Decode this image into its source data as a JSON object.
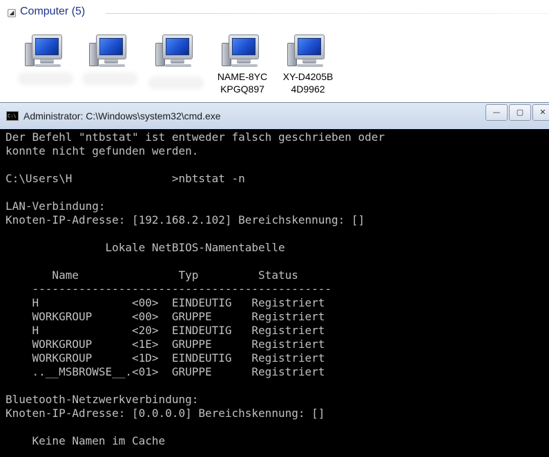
{
  "explorer": {
    "group_title": "Computer (5)",
    "collapse_glyph": "◢",
    "computers": [
      {
        "icon": "computer-icon",
        "label_line1": "",
        "label_line2": "",
        "redacted": true
      },
      {
        "icon": "computer-icon",
        "label_line1": "",
        "label_line2": "",
        "redacted": true
      },
      {
        "icon": "computer-icon",
        "label_line1": "",
        "label_line2": "",
        "redacted": true
      },
      {
        "icon": "computer-icon",
        "label_line1": "NAME-8YC",
        "label_line2": "KPGQ897",
        "redacted": false
      },
      {
        "icon": "computer-icon",
        "label_line1": "XY-D4205B",
        "label_line2": "4D9962",
        "redacted": false
      }
    ]
  },
  "cmd": {
    "icon_text": "C:\\",
    "title": "Administrator: C:\\Windows\\system32\\cmd.exe",
    "minimize_glyph": "—",
    "maximize_glyph": "▢",
    "close_glyph": "✕",
    "lines": [
      "Der Befehl \"ntbstat\" ist entweder falsch geschrieben oder",
      "konnte nicht gefunden werden.",
      "",
      "C:\\Users\\H               >nbtstat -n",
      "",
      "LAN-Verbindung:",
      "Knoten-IP-Adresse: [192.168.2.102] Bereichskennung: []",
      "",
      "               Lokale NetBIOS-Namentabelle",
      "",
      "       Name               Typ         Status",
      "    ---------------------------------------------",
      "    H              <00>  EINDEUTIG   Registriert",
      "    WORKGROUP      <00>  GRUPPE      Registriert",
      "    H              <20>  EINDEUTIG   Registriert",
      "    WORKGROUP      <1E>  GRUPPE      Registriert",
      "    WORKGROUP      <1D>  EINDEUTIG   Registriert",
      "    ..__MSBROWSE__.<01>  GRUPPE      Registriert",
      "",
      "Bluetooth-Netzwerkverbindung:",
      "Knoten-IP-Adresse: [0.0.0.0] Bereichskennung: []",
      "",
      "    Keine Namen im Cache"
    ]
  },
  "colors": {
    "group_title": "#1e3287",
    "console_bg": "#000000",
    "console_fg": "#c0c0c0",
    "titlebar": "#c9d7ea"
  }
}
